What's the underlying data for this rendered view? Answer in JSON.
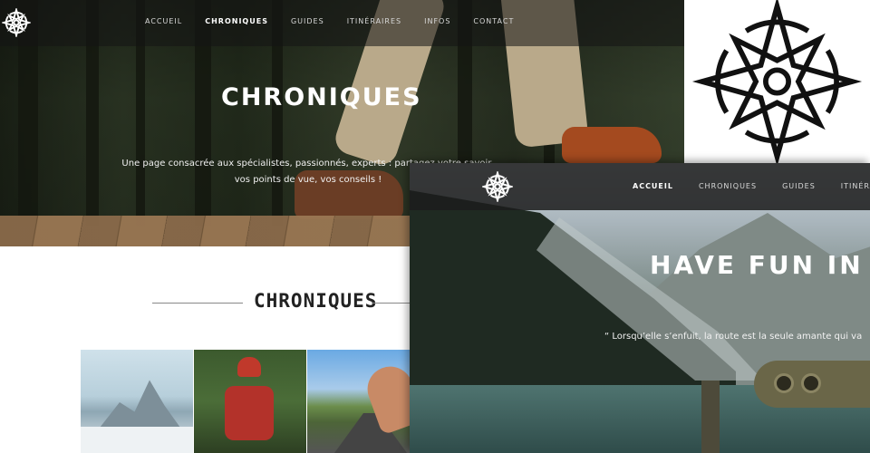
{
  "screen1": {
    "nav": [
      "Accueil",
      "Chroniques",
      "Guides",
      "Itinéraires",
      "Infos",
      "Contact"
    ],
    "active_nav": "Chroniques",
    "hero_title": "CHRONIQUES",
    "hero_subtitle_line1": "Une page consacrée aux spécialistes, passionnés, experts : partagez votre savoir,",
    "hero_subtitle_line2": "vos points de vue, vos conseils !",
    "section_title": "CHRONIQUES"
  },
  "screen2": {
    "nav": [
      "Accueil",
      "Chroniques",
      "Guides",
      "Itinéraires"
    ],
    "active_nav": "Accueil",
    "hero_title": "HAVE FUN IN EU",
    "hero_quote": "“ Lorsqu’elle s’enfuit, la route est la seule amante qui va"
  },
  "icons": {
    "logo": "compass-star-icon"
  },
  "colors": {
    "text_light": "#ffffff",
    "nav_bg": "#1c1c1c",
    "heading_dark": "#222222"
  }
}
